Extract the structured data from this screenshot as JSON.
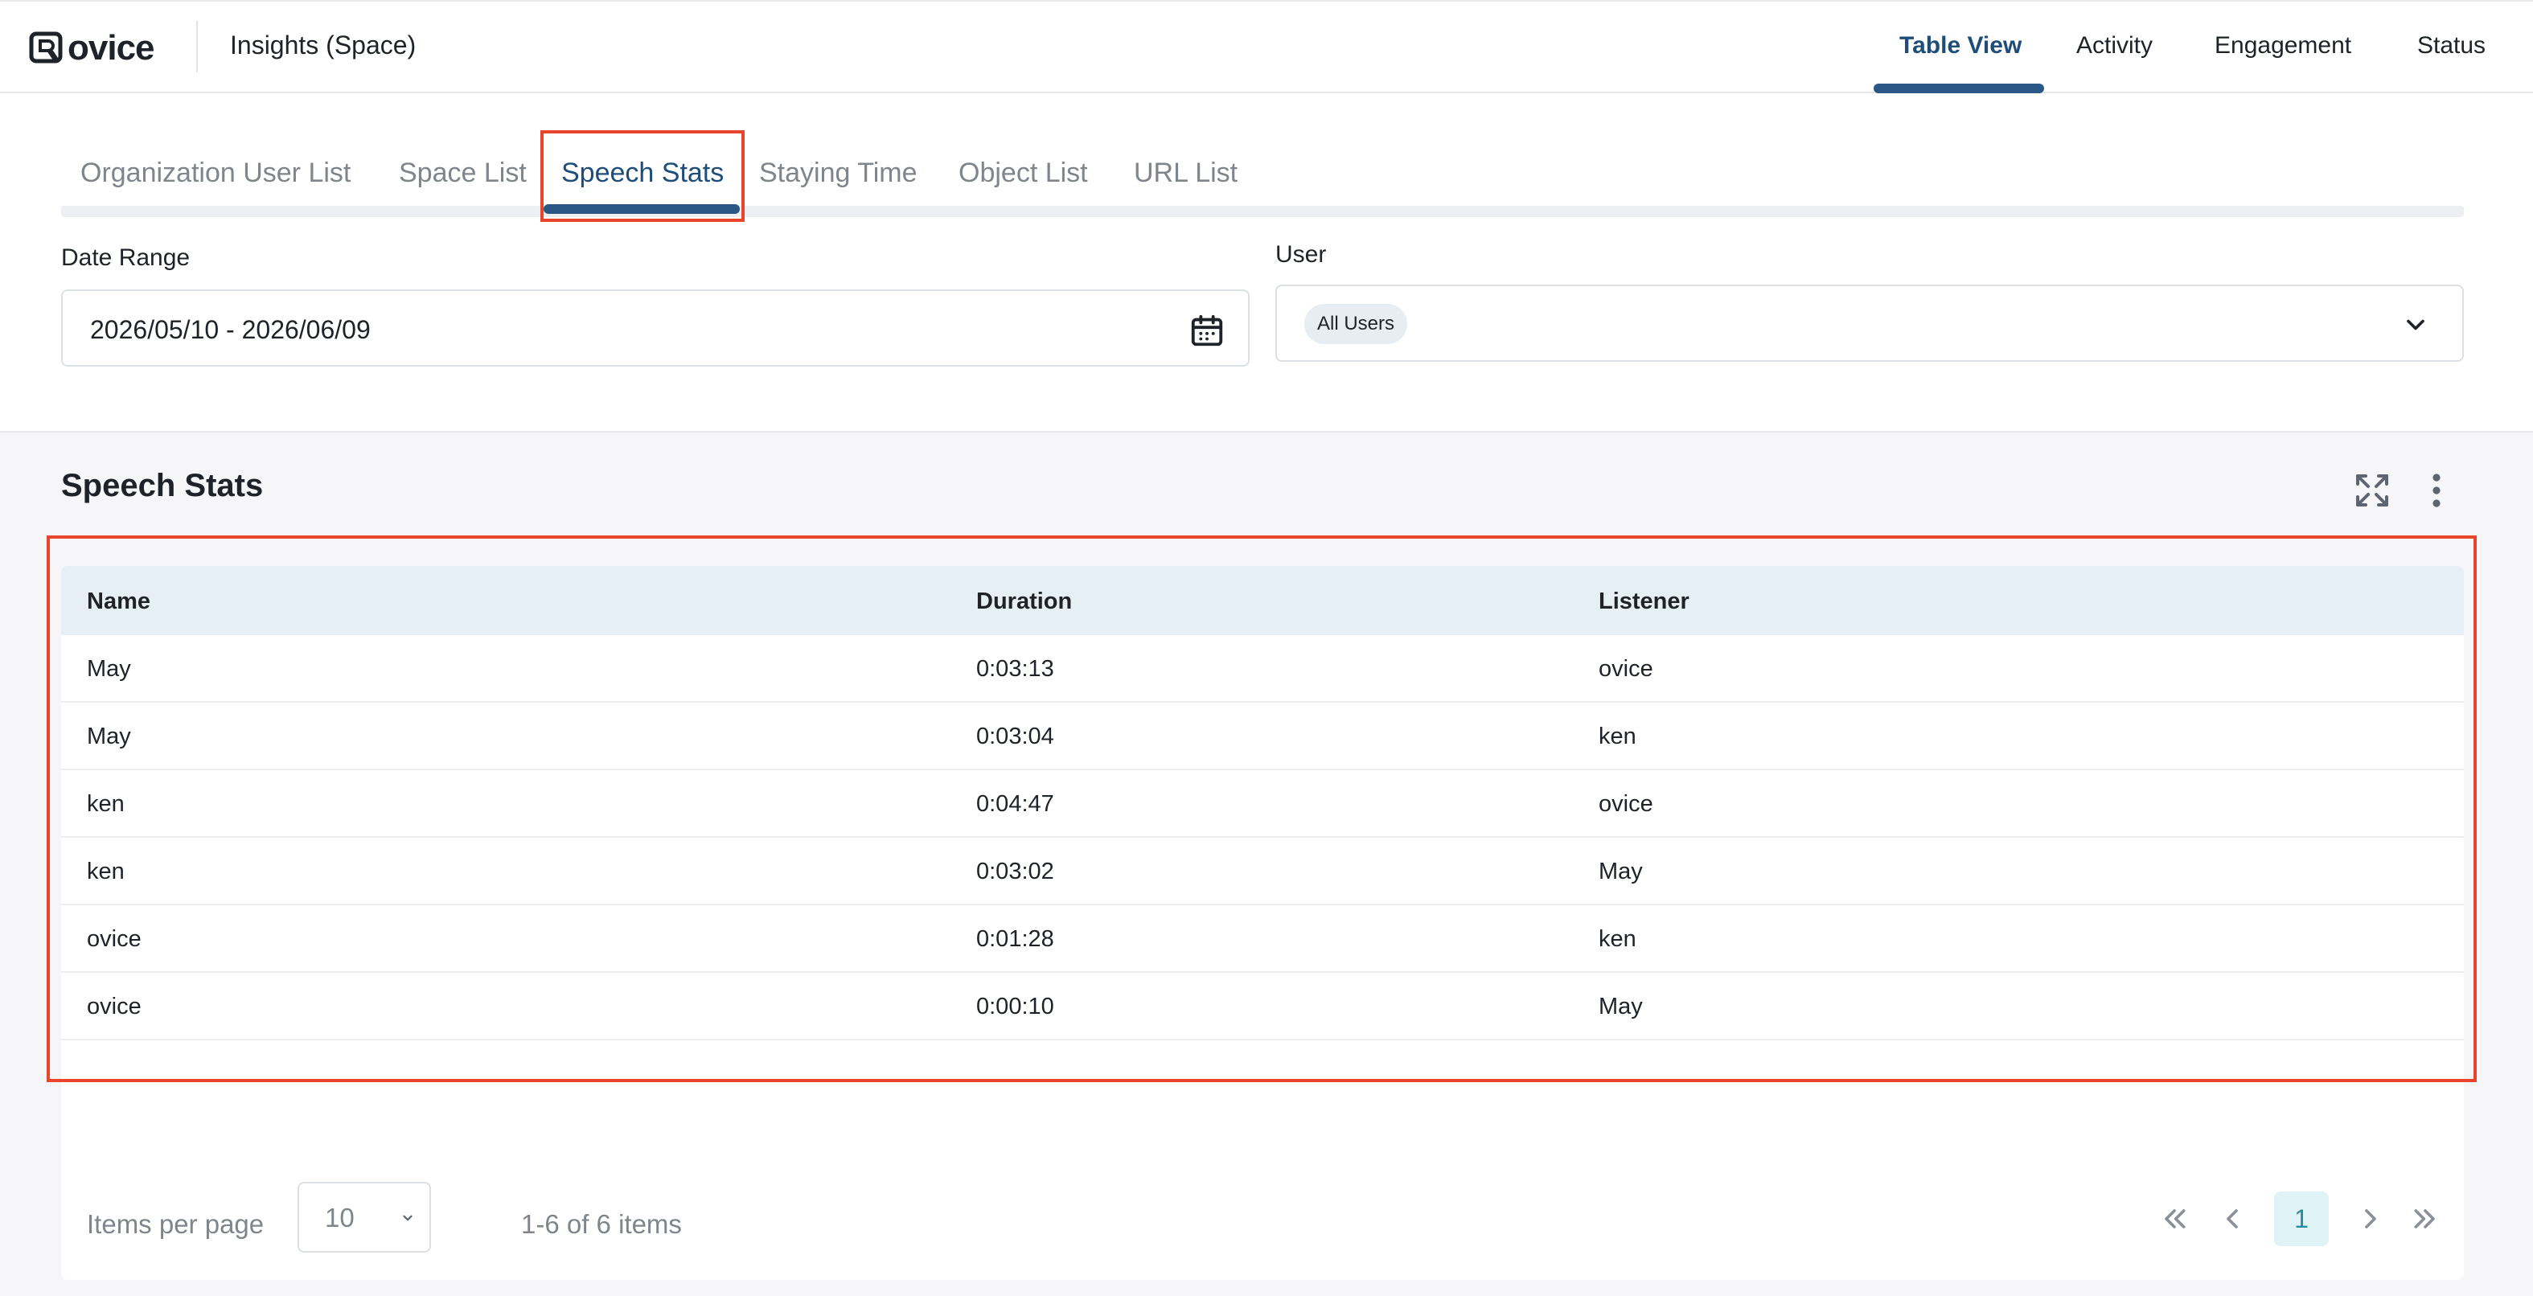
{
  "app": {
    "logo_text": "ovice",
    "title": "Insights (Space)"
  },
  "top_nav": [
    {
      "label": "Table View",
      "active": true
    },
    {
      "label": "Activity",
      "active": false
    },
    {
      "label": "Engagement",
      "active": false
    },
    {
      "label": "Status",
      "active": false
    }
  ],
  "tabs": [
    {
      "label": "Organization User List",
      "active": false
    },
    {
      "label": "Space List",
      "active": false
    },
    {
      "label": "Speech Stats",
      "active": true
    },
    {
      "label": "Staying Time",
      "active": false
    },
    {
      "label": "Object List",
      "active": false
    },
    {
      "label": "URL List",
      "active": false
    }
  ],
  "filters": {
    "date_range": {
      "label": "Date Range",
      "value": "2026/05/10 - 2026/06/09",
      "icon": "calendar-icon"
    },
    "user": {
      "label": "User",
      "chip": "All Users",
      "icon": "chevron-down-icon"
    }
  },
  "section": {
    "title": "Speech Stats",
    "icons": [
      "expand-icon",
      "more-vertical-icon"
    ]
  },
  "table": {
    "columns": [
      "Name",
      "Duration",
      "Listener"
    ],
    "rows": [
      [
        "May",
        "0:03:13",
        "ovice"
      ],
      [
        "May",
        "0:03:04",
        "ken"
      ],
      [
        "ken",
        "0:04:47",
        "ovice"
      ],
      [
        "ken",
        "0:03:02",
        "May"
      ],
      [
        "ovice",
        "0:01:28",
        "ken"
      ],
      [
        "ovice",
        "0:00:10",
        "May"
      ]
    ]
  },
  "pagination": {
    "items_per_page_label": "Items per page",
    "items_per_page": "10",
    "range_text": "1-6 of 6 items",
    "current_page": "1"
  },
  "colors": {
    "accent": "#2a5785",
    "highlight": "#e8452c",
    "table_header": "#e6eff5",
    "current_page_bg": "#dff3f6"
  }
}
